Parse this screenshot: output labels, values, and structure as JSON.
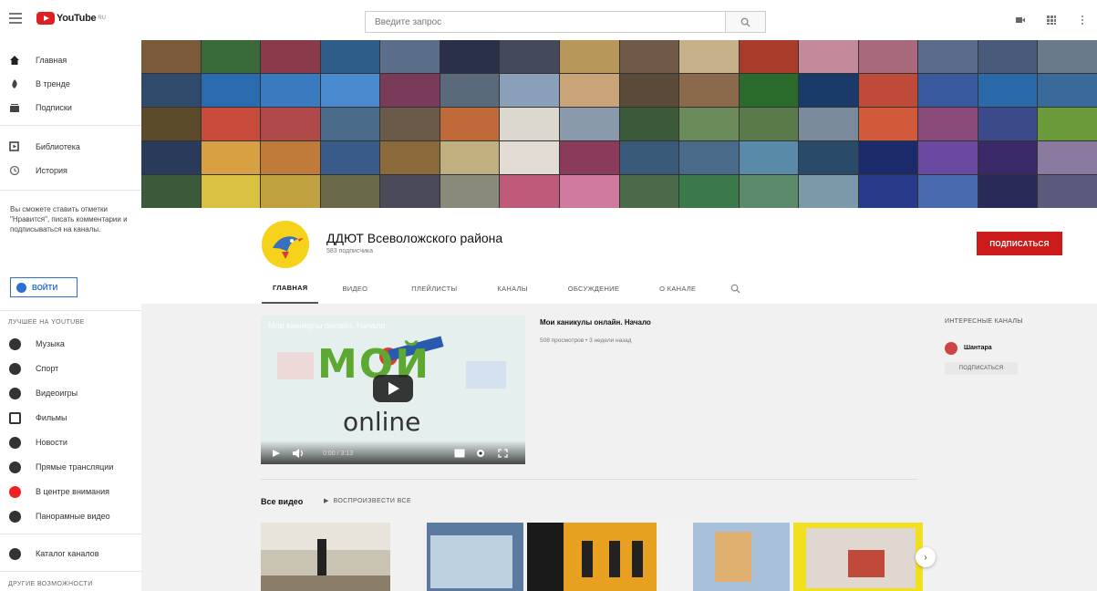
{
  "header": {
    "logo_text": "YouTube",
    "logo_sup": "RU",
    "search_placeholder": "Введите запрос"
  },
  "sidebar": {
    "main_items": [
      {
        "label": "Главная",
        "icon": "home-icon"
      },
      {
        "label": "В тренде",
        "icon": "trending-icon"
      },
      {
        "label": "Подписки",
        "icon": "subscriptions-icon"
      }
    ],
    "lib_items": [
      {
        "label": "Библиотека",
        "icon": "library-icon"
      },
      {
        "label": "История",
        "icon": "history-icon"
      }
    ],
    "signin_text": "Вы сможете ставить отметки \"Нравится\", писать комментарии и подписываться на каналы.",
    "signin_button": "ВОЙТИ",
    "best_title": "ЛУЧШЕЕ НА YOUTUBE",
    "categories": [
      {
        "label": "Музыка"
      },
      {
        "label": "Спорт"
      },
      {
        "label": "Видеоигры"
      },
      {
        "label": "Фильмы"
      },
      {
        "label": "Новости"
      },
      {
        "label": "Прямые трансляции"
      },
      {
        "label": "В центре внимания"
      },
      {
        "label": "Панорамные видео"
      }
    ],
    "catalog": "Каталог каналов",
    "more_title": "ДРУГИЕ ВОЗМОЖНОСТИ"
  },
  "channel": {
    "title": "ДДЮТ Всеволожского района",
    "subscribers": "583 подписчика",
    "subscribe_button": "ПОДПИСАТЬСЯ",
    "tabs": [
      "ГЛАВНАЯ",
      "ВИДЕО",
      "ПЛЕЙЛИСТЫ",
      "КАНАЛЫ",
      "ОБСУЖДЕНИЕ",
      "О КАНАЛЕ"
    ]
  },
  "featured": {
    "overlay_title": "Мои каникулы онлайн. Начало",
    "logo_word1": "МОЙ",
    "logo_word2": "online",
    "time": "0:00 / 3:13",
    "title": "Мои каникулы онлайн. Начало",
    "meta": "508 просмотров • 3 недели назад"
  },
  "all_videos": {
    "title": "Все видео",
    "play_all": "ВОСПРОИЗВЕСТИ ВСЕ"
  },
  "related": {
    "title": "ИНТЕРЕСНЫЕ КАНАЛЫ",
    "channel_name": "Шантара",
    "subscribe": "ПОДПИСАТЬСЯ"
  },
  "colors": {
    "brand_red": "#cc1b1b",
    "link_blue": "#2a6fd1"
  }
}
